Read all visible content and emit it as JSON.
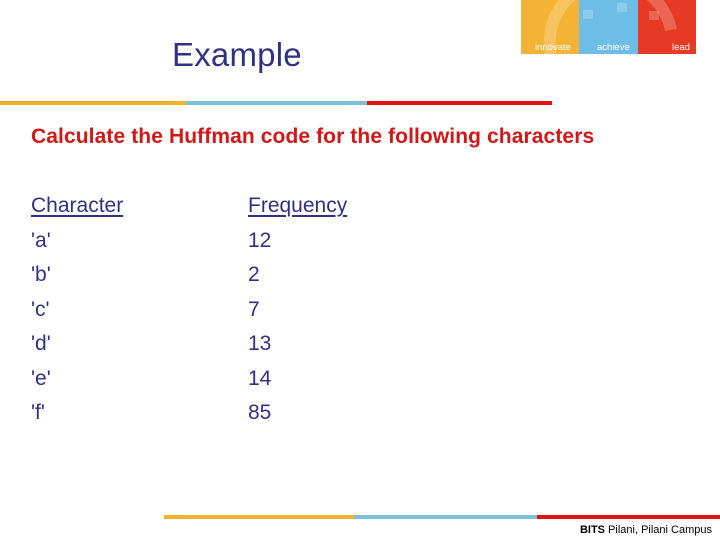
{
  "slide": {
    "title": "Example",
    "subtitle": "Calculate the Huffman code for the following characters",
    "footer_bold": "BITS",
    "footer_rest": " Pilani, Pilani Campus"
  },
  "logo": {
    "words": [
      "innovate",
      "achieve",
      "lead"
    ],
    "colors": [
      "#f5b335",
      "#6dbde6",
      "#e63a25"
    ]
  },
  "rules": {
    "colors": [
      "#f0b429",
      "#7ebfdc",
      "#e31212"
    ]
  },
  "table": {
    "headers": [
      "Character",
      "Frequency"
    ],
    "rows": [
      {
        "character": "'a'",
        "frequency": "12"
      },
      {
        "character": "'b'",
        "frequency": "2"
      },
      {
        "character": "'c'",
        "frequency": "7"
      },
      {
        "character": "'d'",
        "frequency": "13"
      },
      {
        "character": "'e'",
        "frequency": "14"
      },
      {
        "character": "'f'",
        "frequency": "85"
      }
    ]
  }
}
